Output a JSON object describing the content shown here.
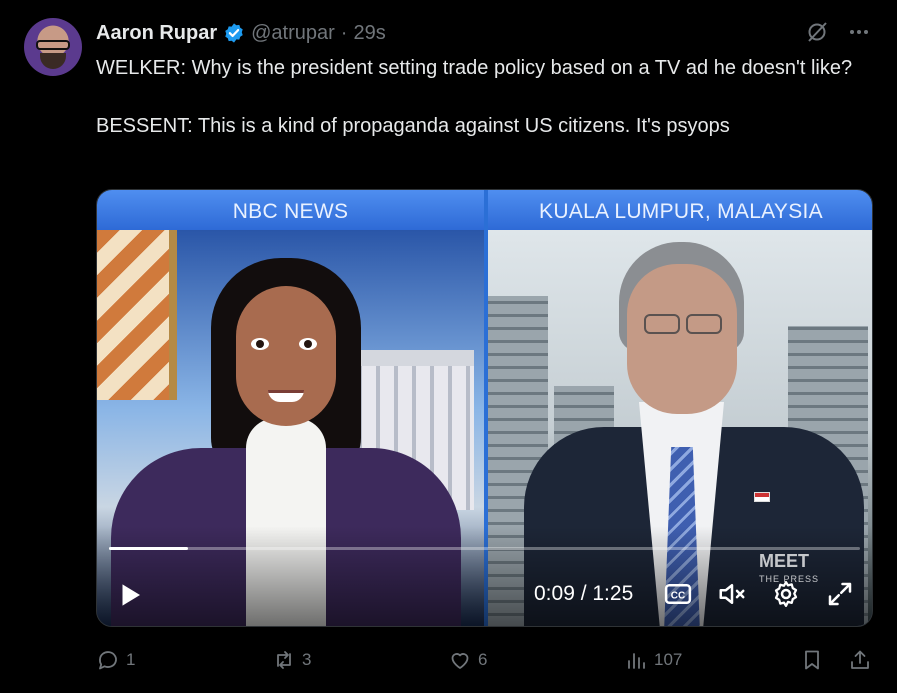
{
  "author": {
    "name": "Aaron Rupar",
    "handle": "@atrupar",
    "separator": "·",
    "time": "29s",
    "verified_icon": "verified-badge-icon"
  },
  "tweet": {
    "text": "WELKER: Why is the president setting trade policy based on a TV ad he doesn't like?\n\nBESSENT: This is a kind of propaganda against US citizens. It's psyops"
  },
  "top_icons": [
    "grok-icon",
    "more-icon"
  ],
  "video": {
    "left_label": "NBC NEWS",
    "right_label": "KUALA LUMPUR, MALAYSIA",
    "timecode": "0:09 / 1:25",
    "progress": 0.105,
    "logo_main": "MEET",
    "logo_sub": "THE PRESS",
    "controls": [
      "play-icon",
      "captions-icon",
      "muted-volume-icon",
      "settings-icon",
      "fullscreen-icon"
    ]
  },
  "actions": {
    "replies": "1",
    "reposts": "3",
    "likes": "6",
    "views": "107"
  },
  "colors": {
    "background": "#000000",
    "text": "#e7e9ea",
    "muted": "#71767b",
    "verified": "#1d9bf0"
  }
}
